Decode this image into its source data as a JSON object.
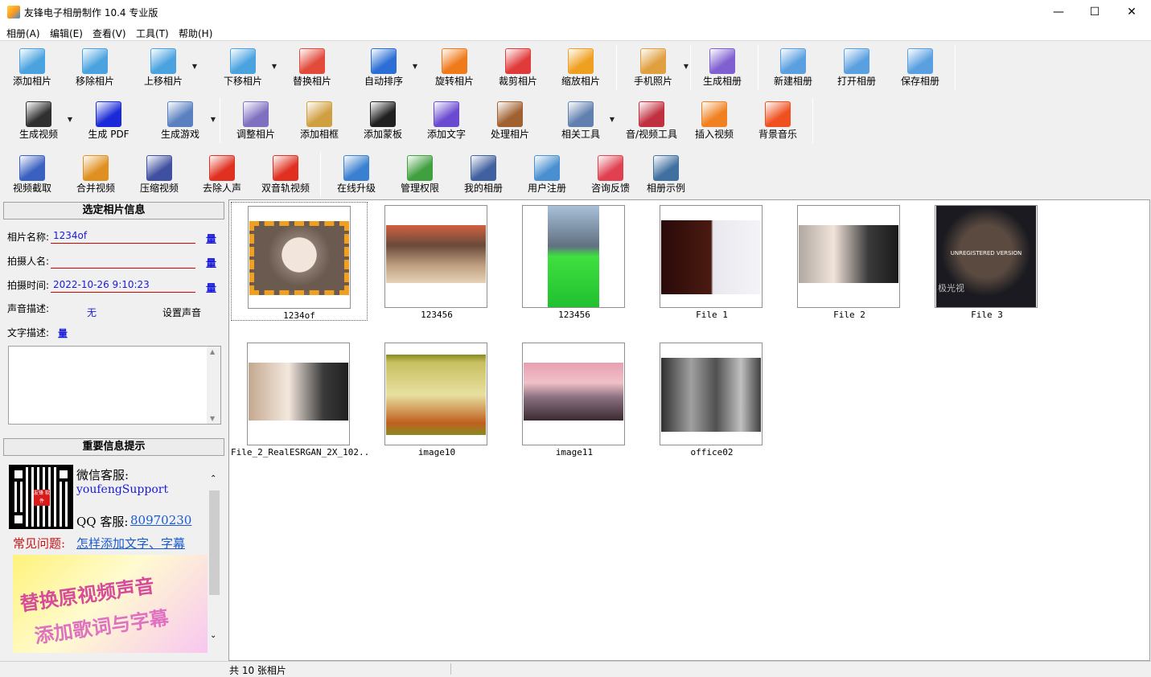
{
  "window": {
    "title": "友锋电子相册制作 10.4 专业版",
    "minimize": "—",
    "maximize": "☐",
    "close": "✕"
  },
  "menu": [
    "相册(A)",
    "编辑(E)",
    "查看(V)",
    "工具(T)",
    "帮助(H)"
  ],
  "toolbar1": [
    {
      "label": "添加相片",
      "icon": "add-photo-icon",
      "color": "#4aa3df"
    },
    {
      "label": "移除相片",
      "icon": "remove-photo-icon",
      "color": "#4aa3df"
    },
    {
      "label": "上移相片",
      "icon": "move-up-photo-icon",
      "color": "#4aa3df"
    },
    {
      "label": "下移相片",
      "icon": "move-down-photo-icon",
      "color": "#4aa3df"
    },
    {
      "label": "替换相片",
      "icon": "replace-photo-icon",
      "color": "#e24a3a"
    },
    {
      "label": "自动排序",
      "icon": "sort-az-icon",
      "color": "#2b6fd6"
    },
    {
      "label": "旋转相片",
      "icon": "rotate-icon",
      "color": "#f07a1a"
    },
    {
      "label": "裁剪相片",
      "icon": "crop-icon",
      "color": "#e03a3a"
    },
    {
      "label": "缩放相片",
      "icon": "zoom-icon",
      "color": "#f0a020"
    },
    {
      "label": "手机照片",
      "icon": "phone-icon",
      "color": "#e0a040"
    },
    {
      "label": "生成相册",
      "icon": "build-album-icon",
      "color": "#8060d0"
    },
    {
      "label": "新建相册",
      "icon": "new-album-icon",
      "color": "#5aa0e0"
    },
    {
      "label": "打开相册",
      "icon": "open-album-icon",
      "color": "#5aa0e0"
    },
    {
      "label": "保存相册",
      "icon": "save-album-icon",
      "color": "#5aa0e0"
    }
  ],
  "toolbar2": [
    {
      "label": "生成视频",
      "icon": "film-icon",
      "color": "#303030"
    },
    {
      "label": "生成 PDF",
      "icon": "pdf-icon",
      "color": "#1a2ad8"
    },
    {
      "label": "生成游戏",
      "icon": "gamepad-icon",
      "color": "#5a80c0"
    },
    {
      "label": "调整相片",
      "icon": "adjust-icon",
      "color": "#8070c0"
    },
    {
      "label": "添加相框",
      "icon": "frame-icon",
      "color": "#d0a040"
    },
    {
      "label": "添加蒙板",
      "icon": "mask-icon",
      "color": "#202020"
    },
    {
      "label": "添加文字",
      "icon": "text-icon",
      "color": "#6a4ad0"
    },
    {
      "label": "处理相片",
      "icon": "process-icon",
      "color": "#a06030"
    },
    {
      "label": "相关工具",
      "icon": "tools-icon",
      "color": "#6080b0"
    },
    {
      "label": "音/视频工具",
      "icon": "av-tools-icon",
      "color": "#c03040"
    },
    {
      "label": "插入视频",
      "icon": "insert-video-icon",
      "color": "#f08020"
    },
    {
      "label": "背景音乐",
      "icon": "music-icon",
      "color": "#f05020"
    }
  ],
  "toolbar3": [
    {
      "label": "视频截取",
      "icon": "video-cut-icon",
      "color": "#3a60c0"
    },
    {
      "label": "合并视频",
      "icon": "merge-video-icon",
      "color": "#e09020"
    },
    {
      "label": "压缩视频",
      "icon": "compress-video-icon",
      "color": "#4050a0"
    },
    {
      "label": "去除人声",
      "icon": "remove-vocal-icon",
      "color": "#e03020"
    },
    {
      "label": "双音轨视频",
      "icon": "dual-audio-icon",
      "color": "#e03020"
    },
    {
      "label": "在线升级",
      "icon": "upgrade-icon",
      "color": "#3a80d0"
    },
    {
      "label": "管理权限",
      "icon": "shield-icon",
      "color": "#40a040"
    },
    {
      "label": "我的相册",
      "icon": "my-album-icon",
      "color": "#4060a0"
    },
    {
      "label": "用户注册",
      "icon": "register-icon",
      "color": "#4a90d0"
    },
    {
      "label": "咨询反馈",
      "icon": "feedback-icon",
      "color": "#e04050"
    },
    {
      "label": "相册示例",
      "icon": "example-icon",
      "color": "#4070a0"
    }
  ],
  "info_panel": {
    "heading": "选定相片信息",
    "name_label": "相片名称:",
    "name_value": "1234of",
    "author_label": "拍摄人名:",
    "author_value": "",
    "time_label": "拍摄时间:",
    "time_value": "2022-10-26 9:10:23",
    "sound_label": "声音描述:",
    "sound_value": "无",
    "set_sound": "设置声音",
    "text_label": "文字描述:",
    "edit_glyph": "量"
  },
  "notice_panel": {
    "heading": "重要信息提示",
    "wechat_label": "微信客服:",
    "wechat_id": "youfengSupport",
    "qq_label": "QQ 客服:",
    "qq_number": "80970230",
    "faq_label": "常见问题:",
    "faq_link": "怎样添加文字、字幕",
    "promo_line1": "替换原视频声音",
    "promo_line2": "添加歌词与字幕",
    "qr_center": "友锋 软件"
  },
  "photos": [
    {
      "caption": "1234of",
      "selected": true
    },
    {
      "caption": "123456"
    },
    {
      "caption": "123456"
    },
    {
      "caption": "File 1"
    },
    {
      "caption": "File 2"
    },
    {
      "caption": "File 3",
      "overlay": "UNREGISTERED VERSION",
      "watermark": "极光视"
    },
    {
      "caption": "File_2_RealESRGAN_2X_102..."
    },
    {
      "caption": "image10"
    },
    {
      "caption": "image11"
    },
    {
      "caption": "office02"
    }
  ],
  "status": {
    "text": "共 10 张相片"
  }
}
